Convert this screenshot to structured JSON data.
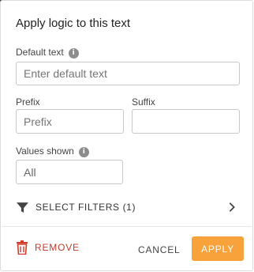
{
  "panel": {
    "title": "Apply logic to this text"
  },
  "fields": {
    "default_text": {
      "label": "Default text",
      "placeholder": "Enter default text"
    },
    "prefix": {
      "label": "Prefix",
      "placeholder": "Prefix"
    },
    "suffix": {
      "label": "Suffix",
      "value": ""
    },
    "values_shown": {
      "label": "Values shown",
      "value": "All"
    }
  },
  "filters": {
    "label": "SELECT FILTERS (1)",
    "icon": "filter-icon",
    "chevron_icon": "chevron-right-icon"
  },
  "footer": {
    "remove_label": "REMOVE",
    "remove_icon": "trash-icon",
    "cancel_label": "CANCEL",
    "apply_label": "APPLY"
  },
  "colors": {
    "accent": "#f7a23b",
    "danger": "#c23a2c",
    "info_icon": "#8c8c8c"
  }
}
